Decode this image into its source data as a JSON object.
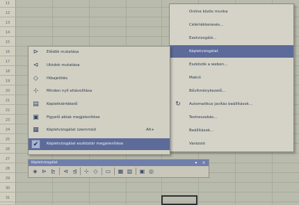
{
  "sheet": {
    "row_numbers": [
      "11",
      "12",
      "13",
      "14",
      "15",
      "16",
      "17",
      "18",
      "19",
      "20",
      "21",
      "22",
      "23",
      "24",
      "25",
      "26",
      "27",
      "28",
      "29",
      "30",
      "31"
    ]
  },
  "right_menu": {
    "items": [
      {
        "label": "Online közös munka",
        "icon": ""
      },
      {
        "label": "Célértékkeresés...",
        "icon": ""
      },
      {
        "label": "Esetvizsgáló...",
        "icon": ""
      },
      {
        "label": "Képletvizsgálat",
        "icon": "",
        "active": true
      },
      {
        "label": "Eszközök a weben...",
        "icon": ""
      },
      {
        "label": "Makró",
        "icon": ""
      },
      {
        "label": "Bővítménykezelő...",
        "icon": ""
      },
      {
        "label": "Automatikus javítás beállítások...",
        "icon": "autocorrect-icon"
      },
      {
        "label": "Testreszabás...",
        "icon": ""
      },
      {
        "label": "Beállítások...",
        "icon": ""
      },
      {
        "label": "Varázsló",
        "icon": ""
      }
    ]
  },
  "left_menu": {
    "items": [
      {
        "label": "Elődök mutatása",
        "icon": "trace-precedents-icon",
        "glyph": "⊳"
      },
      {
        "label": "Utódok mutatása",
        "icon": "trace-dependents-icon",
        "glyph": "⊲"
      },
      {
        "label": "Hibajelölés",
        "icon": "trace-error-icon",
        "glyph": "◇"
      },
      {
        "label": "Minden nyíl eltávolítása",
        "icon": "remove-arrows-icon",
        "glyph": "⊹"
      },
      {
        "label": "Képletkiértékelő",
        "icon": "evaluate-formula-icon",
        "glyph": "▤"
      },
      {
        "label": "Figyelő ablak megjelenítése",
        "icon": "watch-window-icon",
        "glyph": "▣"
      },
      {
        "label": "Képletvizsgálat üzemmód",
        "icon": "formula-mode-icon",
        "glyph": "▦",
        "shortcut": "Alt+"
      },
      {
        "label": "Képletvizsgálat eszköztár megjelenítése",
        "icon": "checkmark-icon",
        "glyph": "✔",
        "checked": true,
        "active": true
      }
    ]
  },
  "toolbar": {
    "title": "Képletvizsgálat",
    "buttons": [
      {
        "icon": "error-check-icon",
        "glyph": "◈"
      },
      {
        "icon": "trace-precedents-icon",
        "glyph": "⊳"
      },
      {
        "icon": "remove-precedent-arrows-icon",
        "glyph": "⊵"
      },
      {
        "icon": "trace-dependents-icon",
        "glyph": "⊲"
      },
      {
        "icon": "remove-dependent-arrows-icon",
        "glyph": "⊴"
      },
      {
        "icon": "remove-all-arrows-icon",
        "glyph": "⊹"
      },
      {
        "icon": "trace-error-icon",
        "glyph": "◇"
      },
      {
        "icon": "new-comment-icon",
        "glyph": "▭"
      },
      {
        "icon": "circle-invalid-data-icon",
        "glyph": "▦"
      },
      {
        "icon": "clear-validation-circles-icon",
        "glyph": "▥"
      },
      {
        "icon": "show-watch-window-icon",
        "glyph": "▣"
      },
      {
        "icon": "evaluate-formula-icon",
        "glyph": "◎"
      }
    ]
  }
}
